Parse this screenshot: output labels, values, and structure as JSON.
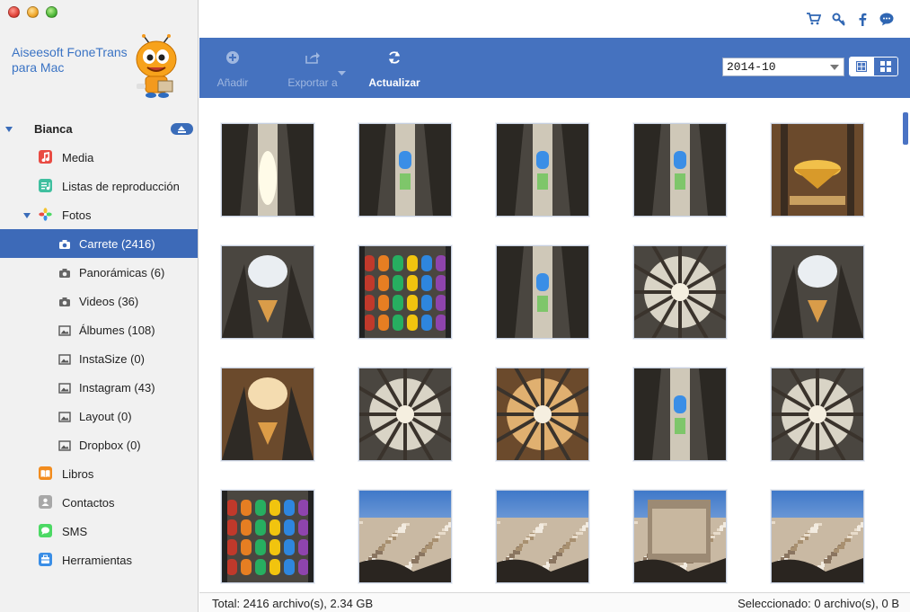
{
  "app": {
    "brand_line1": "Aiseesoft FoneTrans",
    "brand_line2": "para Mac"
  },
  "sidebar": {
    "device": "Bianca",
    "items": [
      {
        "id": "media",
        "label": "Media",
        "icon": "music-icon",
        "color": "#e94b43"
      },
      {
        "id": "playlists",
        "label": "Listas de reproducción",
        "icon": "playlist-icon",
        "color": "#3fbf9f"
      },
      {
        "id": "photos",
        "label": "Fotos",
        "icon": "photos-icon",
        "color": "#f0a030"
      },
      {
        "id": "camera-roll",
        "label": "Carrete (2416)",
        "icon": "camera-icon",
        "selected": true
      },
      {
        "id": "panoramas",
        "label": "Panorámicas (6)",
        "icon": "camera-icon"
      },
      {
        "id": "videos",
        "label": "Videos (36)",
        "icon": "camera-icon"
      },
      {
        "id": "albums",
        "label": "Álbumes (108)",
        "icon": "album-icon"
      },
      {
        "id": "instasize",
        "label": "InstaSize (0)",
        "icon": "album-icon"
      },
      {
        "id": "instagram",
        "label": "Instagram (43)",
        "icon": "album-icon"
      },
      {
        "id": "layout",
        "label": "Layout (0)",
        "icon": "album-icon"
      },
      {
        "id": "dropbox",
        "label": "Dropbox (0)",
        "icon": "album-icon"
      },
      {
        "id": "books",
        "label": "Libros",
        "icon": "book-icon",
        "color": "#f28c1e"
      },
      {
        "id": "contacts",
        "label": "Contactos",
        "icon": "contacts-icon",
        "color": "#9a9a9a"
      },
      {
        "id": "sms",
        "label": "SMS",
        "icon": "sms-icon",
        "color": "#4cd964"
      },
      {
        "id": "tools",
        "label": "Herramientas",
        "icon": "tools-icon",
        "color": "#3a8ee6"
      }
    ]
  },
  "toolbar": {
    "add_label": "Añadir",
    "export_label": "Exportar a",
    "refresh_label": "Actualizar",
    "date_filter": "2014-10"
  },
  "thumbnails": [
    {
      "theme": "nave-light"
    },
    {
      "theme": "nave-window"
    },
    {
      "theme": "nave-window"
    },
    {
      "theme": "pillar-window"
    },
    {
      "theme": "canopy"
    },
    {
      "theme": "vault-light"
    },
    {
      "theme": "stained-glass"
    },
    {
      "theme": "nave-window"
    },
    {
      "theme": "ceiling"
    },
    {
      "theme": "vault-light"
    },
    {
      "theme": "vault-warm"
    },
    {
      "theme": "ceiling"
    },
    {
      "theme": "ceiling-warm"
    },
    {
      "theme": "nave-window"
    },
    {
      "theme": "ceiling"
    },
    {
      "theme": "stained-tall"
    },
    {
      "theme": "city"
    },
    {
      "theme": "city"
    },
    {
      "theme": "city-facade"
    },
    {
      "theme": "city"
    }
  ],
  "status": {
    "total": "Total: 2416 archivo(s), 2.34 GB",
    "selected": "Seleccionado: 0 archivo(s), 0 B"
  },
  "colors": {
    "accent": "#4572bf",
    "selection": "#3d6ab8",
    "brand_text": "#3a73c4"
  }
}
